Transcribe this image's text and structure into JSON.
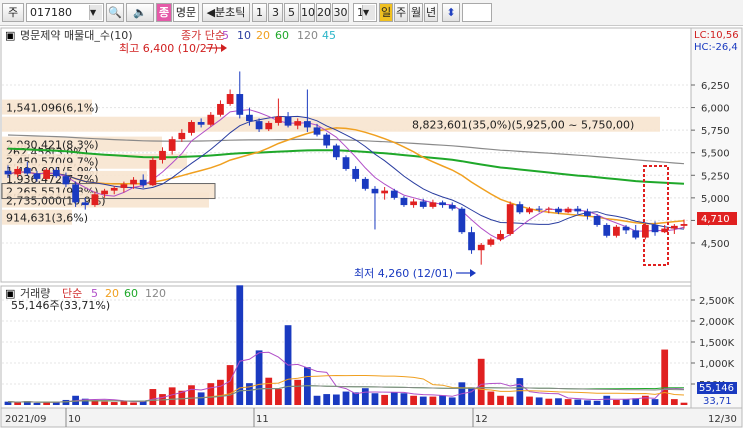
{
  "toolbar": {
    "market": "주",
    "stock_code": "017180",
    "stock_name": "명문",
    "chart_type": "분초틱",
    "periods": [
      "1",
      "3",
      "5",
      "10",
      "20",
      "30"
    ],
    "unit": "1",
    "ranges": [
      "일",
      "주",
      "월",
      "년"
    ],
    "selected_range": "일",
    "color_tag": "종"
  },
  "main": {
    "title": "명문제약 매물대_수(10)",
    "ma_title": "종가 단순",
    "ma_periods": [
      "5",
      "10",
      "20",
      "60",
      "120",
      "45"
    ],
    "ma_colors": [
      "#b14fc8",
      "#2b3ea0",
      "#f0a020",
      "#1fa82a",
      "#888888",
      "#2bb5c8"
    ],
    "high_text": "최고 6,400 (10/27)",
    "low_text": "최저 4,260 (12/01)",
    "lc_text": "LC:10,56",
    "hc_text": "HC:-26,4",
    "price_tag": "4,710",
    "y_labels": [
      "6,250",
      "6,000",
      "5,750",
      "5,500",
      "5,250",
      "5,000",
      "4,750",
      "4,500"
    ],
    "volume_profile": [
      {
        "text": "1,541,096(6,1%)",
        "price": 6000,
        "width": 90
      },
      {
        "text": "2,080,421(8,3%)",
        "price": 5590,
        "width": 160
      },
      {
        "text": "262,458(3,0%)",
        "price": 5510,
        "width": 25
      },
      {
        "text": "2,450,570(9,7%)",
        "price": 5400,
        "width": 185
      },
      {
        "text": "1,490,691(5,9%)",
        "price": 5300,
        "width": 86
      },
      {
        "text": "1,936,472(7,7%)",
        "price": 5210,
        "width": 145
      },
      {
        "text": "2,265,551(9,8%)",
        "price": 5070,
        "width": 213
      },
      {
        "text": "2,735,000(10,9%)",
        "price": 4970,
        "width": 207
      },
      {
        "text": "914,631(3,6%)",
        "price": 4780,
        "width": 70
      },
      {
        "text": "8,823,601(35,0%)(5,925,00 ~ 5,750,00)",
        "price": 5810,
        "width": 400
      }
    ]
  },
  "volume": {
    "title": "거래량",
    "ma_title": "단순",
    "ma_periods": [
      "5",
      "20",
      "60",
      "120"
    ],
    "ma_colors": [
      "#b14fc8",
      "#f0a020",
      "#1fa82a",
      "#888888"
    ],
    "value_text": "55,146주(33,71%)",
    "y_labels": [
      "2,500K",
      "2,000K",
      "1,500K",
      "1,000K",
      "500K"
    ],
    "tag_value": "55,146",
    "tag_pct": "33,71"
  },
  "x_axis": {
    "labels": [
      "2021/09",
      "10",
      "11",
      "12",
      "12/30"
    ]
  },
  "chart_data": {
    "type": "candlestick",
    "title": "명문제약",
    "ylim": [
      4260,
      6500
    ],
    "volume_ylim": [
      0,
      2800
    ],
    "candles": [
      {
        "o": 5300,
        "h": 5360,
        "l": 5220,
        "c": 5260
      },
      {
        "o": 5260,
        "h": 5350,
        "l": 5230,
        "c": 5320
      },
      {
        "o": 5330,
        "h": 5400,
        "l": 5250,
        "c": 5270
      },
      {
        "o": 5270,
        "h": 5300,
        "l": 5180,
        "c": 5210
      },
      {
        "o": 5210,
        "h": 5330,
        "l": 5200,
        "c": 5310
      },
      {
        "o": 5310,
        "h": 5340,
        "l": 5220,
        "c": 5240
      },
      {
        "o": 5240,
        "h": 5280,
        "l": 5120,
        "c": 5150
      },
      {
        "o": 5150,
        "h": 5180,
        "l": 4900,
        "c": 4950
      },
      {
        "o": 4950,
        "h": 5000,
        "l": 4870,
        "c": 4920
      },
      {
        "o": 4920,
        "h": 5070,
        "l": 4900,
        "c": 5040
      },
      {
        "o": 5040,
        "h": 5100,
        "l": 5000,
        "c": 5080
      },
      {
        "o": 5080,
        "h": 5130,
        "l": 5040,
        "c": 5110
      },
      {
        "o": 5110,
        "h": 5180,
        "l": 5060,
        "c": 5150
      },
      {
        "o": 5150,
        "h": 5230,
        "l": 5100,
        "c": 5200
      },
      {
        "o": 5200,
        "h": 5260,
        "l": 5110,
        "c": 5140
      },
      {
        "o": 5140,
        "h": 5450,
        "l": 5130,
        "c": 5420
      },
      {
        "o": 5420,
        "h": 5560,
        "l": 5380,
        "c": 5520
      },
      {
        "o": 5520,
        "h": 5680,
        "l": 5480,
        "c": 5650
      },
      {
        "o": 5650,
        "h": 5760,
        "l": 5620,
        "c": 5720
      },
      {
        "o": 5720,
        "h": 5860,
        "l": 5690,
        "c": 5840
      },
      {
        "o": 5840,
        "h": 5880,
        "l": 5780,
        "c": 5810
      },
      {
        "o": 5810,
        "h": 5950,
        "l": 5790,
        "c": 5920
      },
      {
        "o": 5920,
        "h": 6080,
        "l": 5900,
        "c": 6040
      },
      {
        "o": 6040,
        "h": 6200,
        "l": 6020,
        "c": 6150
      },
      {
        "o": 6150,
        "h": 6400,
        "l": 5880,
        "c": 5920
      },
      {
        "o": 5920,
        "h": 6000,
        "l": 5800,
        "c": 5850
      },
      {
        "o": 5850,
        "h": 5880,
        "l": 5730,
        "c": 5760
      },
      {
        "o": 5760,
        "h": 5850,
        "l": 5740,
        "c": 5830
      },
      {
        "o": 5830,
        "h": 6100,
        "l": 5800,
        "c": 5900
      },
      {
        "o": 5900,
        "h": 5950,
        "l": 5780,
        "c": 5800
      },
      {
        "o": 5800,
        "h": 5880,
        "l": 5760,
        "c": 5850
      },
      {
        "o": 5850,
        "h": 6200,
        "l": 5730,
        "c": 5780
      },
      {
        "o": 5780,
        "h": 5820,
        "l": 5680,
        "c": 5700
      },
      {
        "o": 5700,
        "h": 5720,
        "l": 5550,
        "c": 5580
      },
      {
        "o": 5580,
        "h": 5600,
        "l": 5420,
        "c": 5450
      },
      {
        "o": 5450,
        "h": 5470,
        "l": 5300,
        "c": 5320
      },
      {
        "o": 5320,
        "h": 5350,
        "l": 5180,
        "c": 5210
      },
      {
        "o": 5210,
        "h": 5230,
        "l": 5080,
        "c": 5100
      },
      {
        "o": 5100,
        "h": 5130,
        "l": 4650,
        "c": 5050
      },
      {
        "o": 5050,
        "h": 5120,
        "l": 4980,
        "c": 5080
      },
      {
        "o": 5080,
        "h": 5100,
        "l": 4980,
        "c": 5000
      },
      {
        "o": 5000,
        "h": 5020,
        "l": 4900,
        "c": 4920
      },
      {
        "o": 4920,
        "h": 4990,
        "l": 4890,
        "c": 4960
      },
      {
        "o": 4960,
        "h": 4990,
        "l": 4880,
        "c": 4900
      },
      {
        "o": 4900,
        "h": 4980,
        "l": 4880,
        "c": 4950
      },
      {
        "o": 4950,
        "h": 4970,
        "l": 4890,
        "c": 4920
      },
      {
        "o": 4920,
        "h": 4950,
        "l": 4860,
        "c": 4880
      },
      {
        "o": 4880,
        "h": 4900,
        "l": 4600,
        "c": 4620
      },
      {
        "o": 4620,
        "h": 4680,
        "l": 4380,
        "c": 4420
      },
      {
        "o": 4420,
        "h": 4500,
        "l": 4260,
        "c": 4480
      },
      {
        "o": 4480,
        "h": 4560,
        "l": 4460,
        "c": 4540
      },
      {
        "o": 4540,
        "h": 4640,
        "l": 4520,
        "c": 4600
      },
      {
        "o": 4600,
        "h": 4960,
        "l": 4580,
        "c": 4930
      },
      {
        "o": 4930,
        "h": 4960,
        "l": 4820,
        "c": 4840
      },
      {
        "o": 4840,
        "h": 4900,
        "l": 4820,
        "c": 4880
      },
      {
        "o": 4880,
        "h": 4910,
        "l": 4840,
        "c": 4870
      },
      {
        "o": 4870,
        "h": 4900,
        "l": 4830,
        "c": 4880
      },
      {
        "o": 4880,
        "h": 4900,
        "l": 4820,
        "c": 4840
      },
      {
        "o": 4840,
        "h": 4900,
        "l": 4830,
        "c": 4880
      },
      {
        "o": 4880,
        "h": 4910,
        "l": 4820,
        "c": 4850
      },
      {
        "o": 4850,
        "h": 4880,
        "l": 4760,
        "c": 4800
      },
      {
        "o": 4800,
        "h": 4820,
        "l": 4680,
        "c": 4700
      },
      {
        "o": 4700,
        "h": 4720,
        "l": 4560,
        "c": 4580
      },
      {
        "o": 4580,
        "h": 4700,
        "l": 4560,
        "c": 4680
      },
      {
        "o": 4680,
        "h": 4700,
        "l": 4600,
        "c": 4640
      },
      {
        "o": 4640,
        "h": 4700,
        "l": 4540,
        "c": 4560
      },
      {
        "o": 4560,
        "h": 4720,
        "l": 4540,
        "c": 4700
      },
      {
        "o": 4700,
        "h": 4740,
        "l": 4580,
        "c": 4620
      },
      {
        "o": 4620,
        "h": 4700,
        "l": 4610,
        "c": 4660
      },
      {
        "o": 4660,
        "h": 4710,
        "l": 4600,
        "c": 4690
      },
      {
        "o": 4690,
        "h": 4760,
        "l": 4660,
        "c": 4710
      }
    ],
    "volumes": [
      80,
      60,
      90,
      50,
      70,
      60,
      120,
      220,
      150,
      110,
      80,
      70,
      90,
      60,
      100,
      380,
      260,
      420,
      340,
      470,
      300,
      520,
      600,
      950,
      2850,
      520,
      1300,
      650,
      380,
      1900,
      600,
      900,
      220,
      260,
      250,
      320,
      300,
      400,
      280,
      240,
      300,
      280,
      220,
      200,
      200,
      230,
      180,
      540,
      420,
      1100,
      320,
      220,
      200,
      640,
      200,
      180,
      150,
      160,
      140,
      130,
      110,
      100,
      220,
      120,
      140,
      160,
      220,
      140,
      1320,
      140,
      55
    ]
  }
}
